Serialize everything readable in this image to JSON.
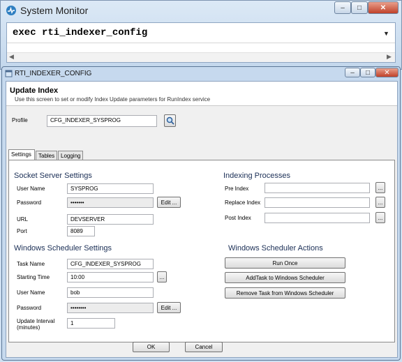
{
  "outer_window": {
    "title": "System Monitor",
    "command": "exec rti_indexer_config",
    "caption_buttons": {
      "minimize": "–",
      "maximize": "□",
      "close": "✕"
    }
  },
  "dialog": {
    "title": "RTI_INDEXER_CONFIG",
    "header_title": "Update Index",
    "header_desc": "Use this screen to set or modify Index Update parameters for RunIndex service",
    "profile_label": "Profile",
    "profile_value": "CFG_INDEXER_SYSPROG",
    "tabs": [
      "Settings",
      "Tables",
      "Logging"
    ],
    "socket": {
      "heading": "Socket Server Settings",
      "user_label": "User Name",
      "user_value": "SYSPROG",
      "pass_label": "Password",
      "pass_value": "•••••••",
      "edit_label": "Edit ...",
      "url_label": "URL",
      "url_value": "DEVSERVER",
      "port_label": "Port",
      "port_value": "8089"
    },
    "indexing": {
      "heading": "Indexing Processes",
      "pre_label": "Pre Index",
      "replace_label": "Replace Index",
      "post_label": "Post Index",
      "browse_label": "..."
    },
    "scheduler": {
      "heading": "Windows Scheduler Settings",
      "task_label": "Task Name",
      "task_value": "CFG_INDEXER_SYSPROG",
      "start_label": "Starting Time",
      "start_value": "10:00",
      "user_label": "User Name",
      "user_value": "bob",
      "pass_label": "Password",
      "pass_value": "••••••••",
      "edit_label": "Edit ...",
      "interval_label_1": "Update Interval",
      "interval_label_2": "(minutes)",
      "interval_value": "1",
      "browse_label": "..."
    },
    "actions": {
      "heading": "Windows Scheduler Actions",
      "run_once": "Run Once",
      "add_task": "AddTask to Windows Scheduler",
      "remove_task": "Remove Task from Windows Scheduler"
    },
    "footer": {
      "ok": "OK",
      "cancel": "Cancel"
    }
  }
}
